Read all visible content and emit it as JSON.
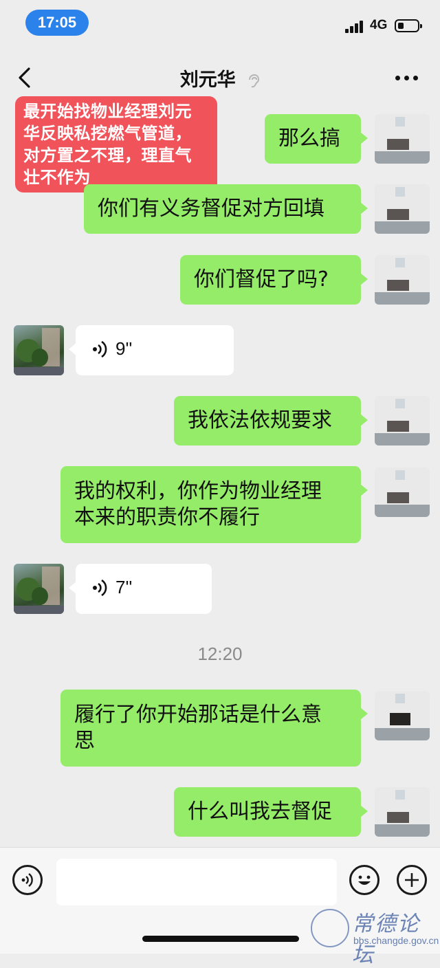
{
  "status_bar": {
    "time": "17:05",
    "network": "4G"
  },
  "nav": {
    "title": "刘元华"
  },
  "annotation": {
    "lines": [
      "最开始找物业经理刘元",
      "华反映私挖燃气管道，",
      "对方置之不理，理直气",
      "壮不作为"
    ]
  },
  "messages": [
    {
      "from": "self",
      "type": "text",
      "lines": [
        "那么搞"
      ]
    },
    {
      "from": "self",
      "type": "text",
      "lines": [
        "你们有义务督促对方回填"
      ]
    },
    {
      "from": "self",
      "type": "text",
      "lines": [
        "你们督促了吗?"
      ]
    },
    {
      "from": "other",
      "type": "voice",
      "duration": "9''"
    },
    {
      "from": "self",
      "type": "text",
      "lines": [
        "我依法依规要求"
      ]
    },
    {
      "from": "self",
      "type": "text",
      "lines": [
        "我的权利，你作为物业经理",
        "本来的职责你不履行"
      ]
    },
    {
      "from": "other",
      "type": "voice",
      "duration": "7''"
    },
    {
      "type": "timestamp",
      "text": "12:20"
    },
    {
      "from": "self",
      "type": "text",
      "lines": [
        "履行了你开始那话是什么意",
        "思"
      ]
    },
    {
      "from": "self",
      "type": "text",
      "lines": [
        "什么叫我去督促"
      ]
    }
  ],
  "input_bar": {
    "voice_icon": "voice-input-icon",
    "emoji_icon": "emoji-icon",
    "plus_icon": "plus-icon"
  },
  "watermark": {
    "title": "常德论坛",
    "url": "bbs.changde.gov.cn"
  },
  "colors": {
    "self_bubble": "#95ec69",
    "other_bubble": "#ffffff",
    "annotation": "#f1535a",
    "time_pill": "#2a82ea"
  }
}
